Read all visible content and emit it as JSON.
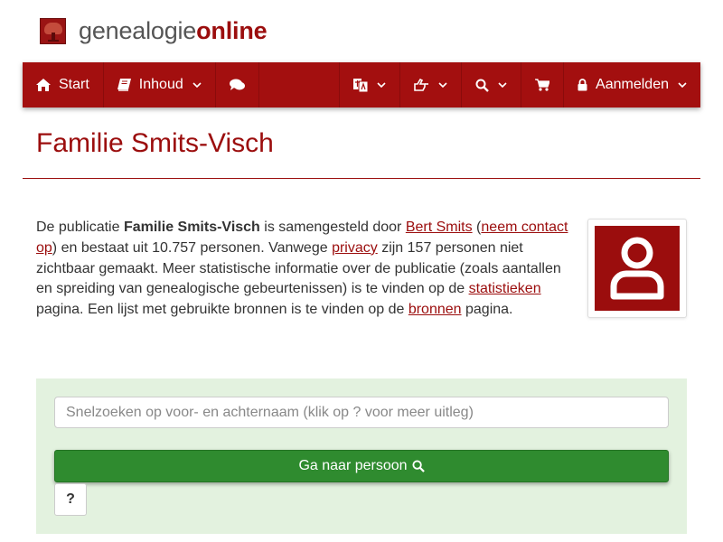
{
  "site": {
    "logo_text_main": "genealogie",
    "logo_text_accent": "online",
    "logo_icon": "tree-logo-icon"
  },
  "nav": {
    "start_label": "Start",
    "start_icon": "home-icon",
    "content_label": "Inhoud",
    "content_icon": "book-icon",
    "chat_icon": "comments-icon",
    "language_icon": "language-icon",
    "share_icon": "share-icon",
    "search_icon": "search-icon",
    "cart_icon": "cart-icon",
    "login_label": "Aanmelden",
    "login_icon": "lock-icon"
  },
  "page": {
    "title": "Familie Smits-Visch"
  },
  "intro": {
    "t1": "De publicatie ",
    "pub_name": "Familie Smits-Visch",
    "t2": " is samengesteld door ",
    "author_link": "Bert Smits",
    "t3": " (",
    "contact_link": "neem contact op",
    "t4": ") en bestaat uit 10.757 personen. Vanwege ",
    "privacy_link": "privacy",
    "t5": " zijn 157 personen niet zichtbaar gemaakt. Meer statistische informatie over de publicatie (zoals aantallen en spreiding van genealogische gebeurtenissen) is te vinden op de ",
    "stats_link": "statistieken",
    "t6": " pagina. Een lijst met gebruikte bronnen is te vinden op de ",
    "sources_link": "bronnen",
    "t7": " pagina."
  },
  "avatar": {
    "icon": "user-icon"
  },
  "search": {
    "placeholder": "Snelzoeken op voor- en achternaam (klik op ? voor meer uitleg)",
    "value": "",
    "go_label": "Ga naar persoon",
    "help_label": "?"
  },
  "colors": {
    "brand": "#a30f0f",
    "accent_text": "#9b0d0d",
    "panel_bg": "#e3f2df",
    "button_green": "#2f8b2f"
  }
}
